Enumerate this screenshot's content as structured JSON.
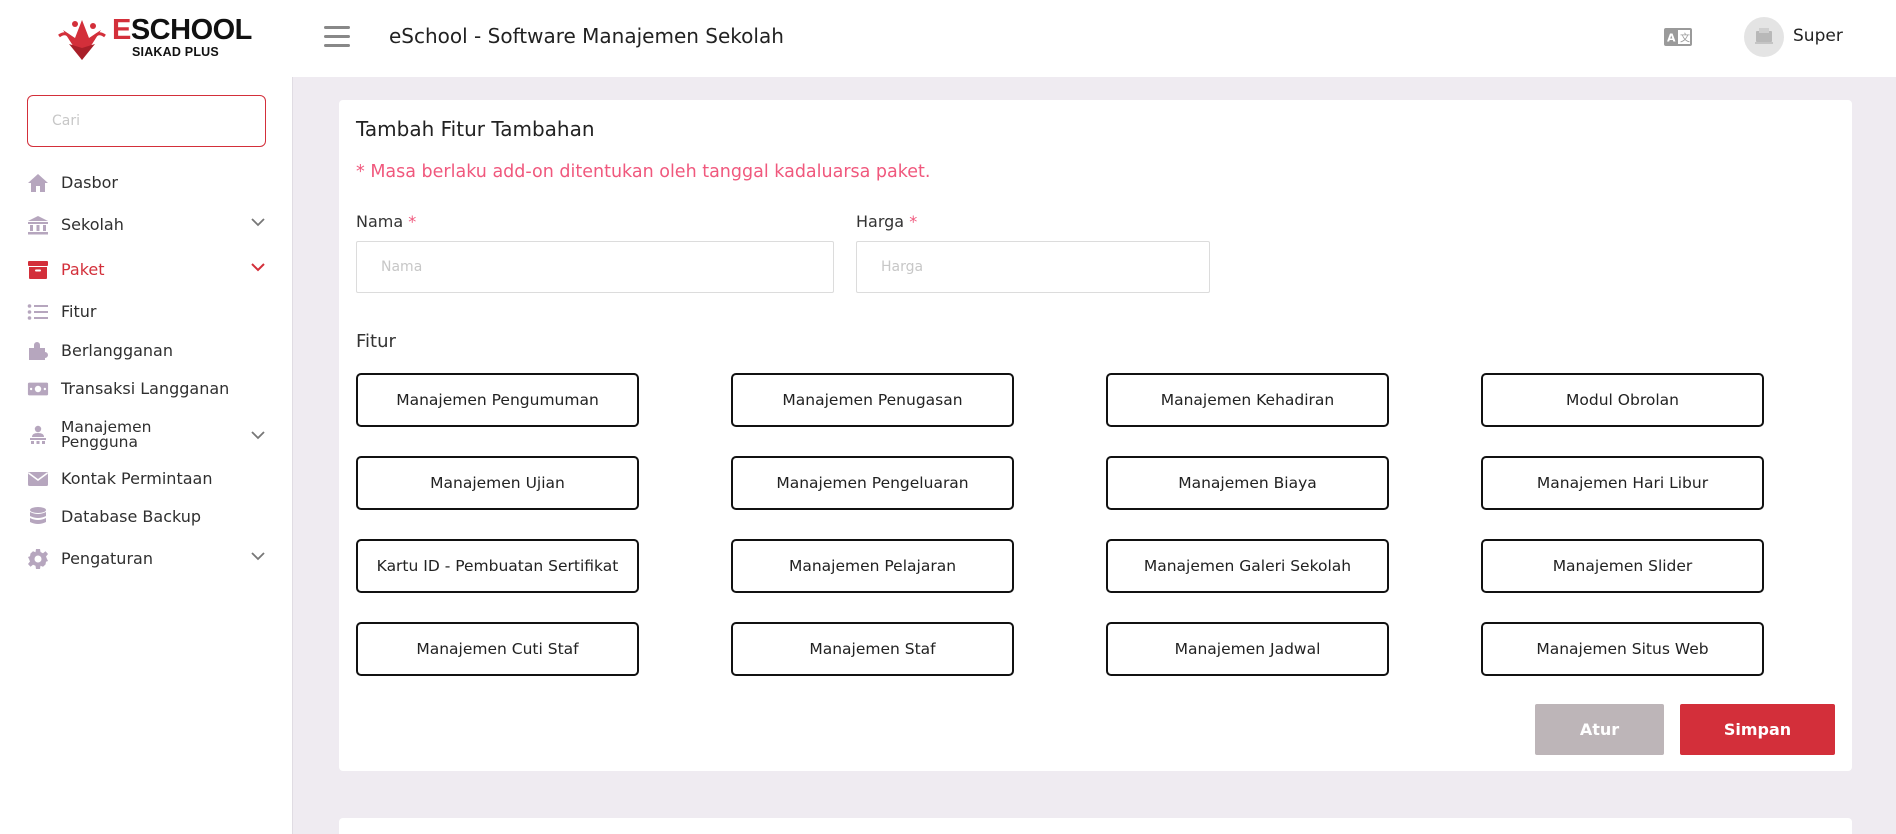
{
  "brand": {
    "name_first": "E",
    "name_rest": "SCHOOL",
    "subtitle": "SIAKAD PLUS",
    "accent": "#d32f3a"
  },
  "header": {
    "title": "eSchool - Software Manajemen Sekolah",
    "user_name": "Super",
    "icons": [
      "menu-icon",
      "language-icon",
      "avatar"
    ]
  },
  "sidebar": {
    "search_placeholder": "Cari",
    "items": [
      {
        "label": "Dasbor",
        "icon": "home-icon"
      },
      {
        "label": "Sekolah",
        "icon": "school-icon",
        "expandable": true
      },
      {
        "label": "Paket",
        "icon": "package-icon",
        "expandable": true,
        "active": true
      },
      {
        "label": "Fitur",
        "icon": "list-icon"
      },
      {
        "label": "Berlangganan",
        "icon": "puzzle-icon"
      },
      {
        "label": "Transaksi Langganan",
        "icon": "money-icon"
      },
      {
        "label": "Manajemen Pengguna",
        "icon": "users-icon",
        "expandable": true
      },
      {
        "label": "Kontak Permintaan",
        "icon": "mail-icon"
      },
      {
        "label": "Database Backup",
        "icon": "database-icon"
      },
      {
        "label": "Pengaturan",
        "icon": "gear-icon",
        "expandable": true
      }
    ]
  },
  "form": {
    "title": "Tambah Fitur Tambahan",
    "note": "* Masa berlaku add-on ditentukan oleh tanggal kadaluarsa paket.",
    "name_label": "Nama",
    "name_placeholder": "Nama",
    "price_label": "Harga",
    "price_placeholder": "Harga",
    "required_mark": "*",
    "features_label": "Fitur",
    "features": [
      "Manajemen Pengumuman",
      "Manajemen Penugasan",
      "Manajemen Kehadiran",
      "Modul Obrolan",
      "Manajemen Ujian",
      "Manajemen Pengeluaran",
      "Manajemen Biaya",
      "Manajemen Hari Libur",
      "Kartu ID - Pembuatan Sertifikat",
      "Manajemen Pelajaran",
      "Manajemen Galeri Sekolah",
      "Manajemen Slider",
      "Manajemen Cuti Staf",
      "Manajemen Staf",
      "Manajemen Jadwal",
      "Manajemen Situs Web"
    ],
    "reset_label": "Atur",
    "save_label": "Simpan"
  },
  "colors": {
    "accent": "#d32f3a",
    "note": "#f0587d",
    "icon": "#b6a6be",
    "reset_button": "#bdb5b8",
    "background": "#efebf1"
  }
}
